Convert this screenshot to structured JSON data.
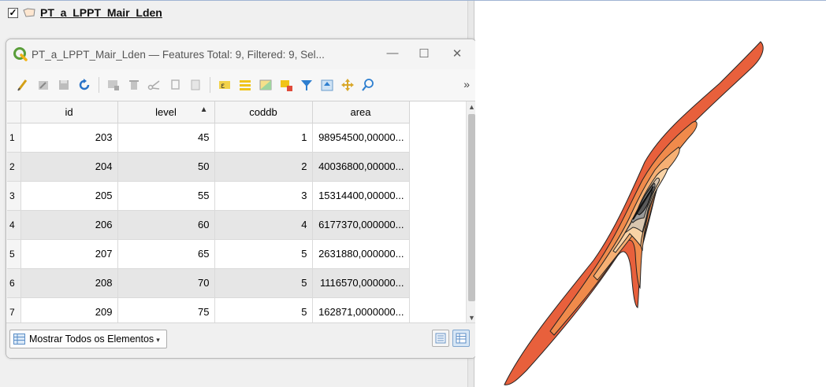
{
  "layer_panel": {
    "checkbox": "✓",
    "layer_name": "PT_a_LPPT_Mair_Lden"
  },
  "attribute_window": {
    "title": "PT_a_LPPT_Mair_Lden — Features Total: 9, Filtered: 9, Sel...",
    "minimize": "—",
    "maximize": "☐",
    "close": "✕",
    "more": "»"
  },
  "table": {
    "columns": [
      "id",
      "level",
      "coddb",
      "area"
    ],
    "sort_indicator": "▲",
    "rows": [
      {
        "n": "1",
        "id": "203",
        "level": "45",
        "coddb": "1",
        "area": "98954500,00000..."
      },
      {
        "n": "2",
        "id": "204",
        "level": "50",
        "coddb": "2",
        "area": "40036800,00000..."
      },
      {
        "n": "3",
        "id": "205",
        "level": "55",
        "coddb": "3",
        "area": "15314400,00000..."
      },
      {
        "n": "4",
        "id": "206",
        "level": "60",
        "coddb": "4",
        "area": "6177370,000000..."
      },
      {
        "n": "5",
        "id": "207",
        "level": "65",
        "coddb": "5",
        "area": "2631880,000000..."
      },
      {
        "n": "6",
        "id": "208",
        "level": "70",
        "coddb": "5",
        "area": "1116570,000000..."
      },
      {
        "n": "7",
        "id": "209",
        "level": "75",
        "coddb": "5",
        "area": "162871,0000000..."
      }
    ]
  },
  "bottom_bar": {
    "show_all_label": "Mostrar Todos os Elementos",
    "dropdown_arrow": "▾"
  },
  "colors": {
    "contour_45": "#e8603c",
    "contour_50": "#f08a4b",
    "contour_55": "#f6b074",
    "contour_60": "#f9d3a6",
    "contour_65": "#d9c6b0",
    "contour_70": "#9a9a9a",
    "contour_75": "#5a5a5a"
  }
}
